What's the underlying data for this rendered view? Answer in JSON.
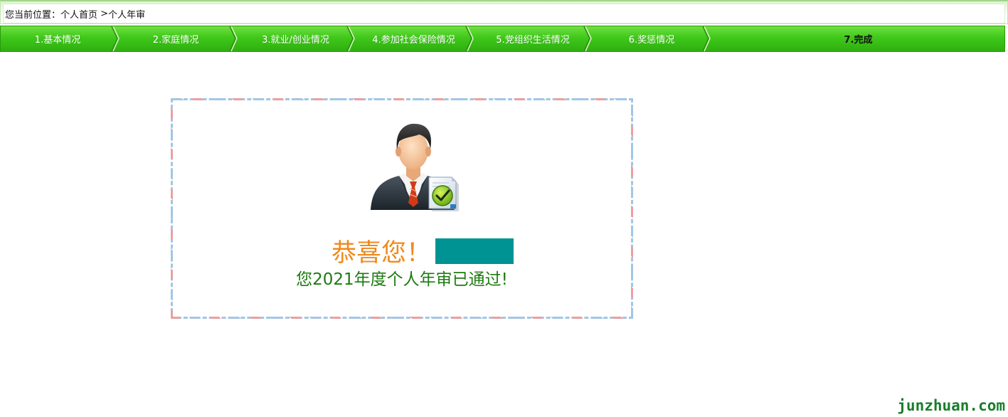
{
  "breadcrumb": {
    "prefix": "您当前位置：",
    "home": "个人首页",
    "separator": " >",
    "current": "个人年审"
  },
  "steps": [
    {
      "label": "1.基本情况",
      "active": false
    },
    {
      "label": "2.家庭情况",
      "active": false
    },
    {
      "label": "3.就业/创业情况",
      "active": false
    },
    {
      "label": "4.参加社会保险情况",
      "active": false
    },
    {
      "label": "5.党组织生活情况",
      "active": false
    },
    {
      "label": "6.奖惩情况",
      "active": false
    },
    {
      "label": "7.完成",
      "active": true
    }
  ],
  "result": {
    "avatar_icon": "businessman-approved-icon",
    "congrats": "恭喜您！",
    "message": "您2021年度个人年审已通过!"
  },
  "watermark": "junzhuan.com",
  "colors": {
    "steps_green": "#3fc81a",
    "congrats_orange": "#ee8a1e",
    "message_green": "#1e7a12",
    "redaction": "#009393"
  }
}
